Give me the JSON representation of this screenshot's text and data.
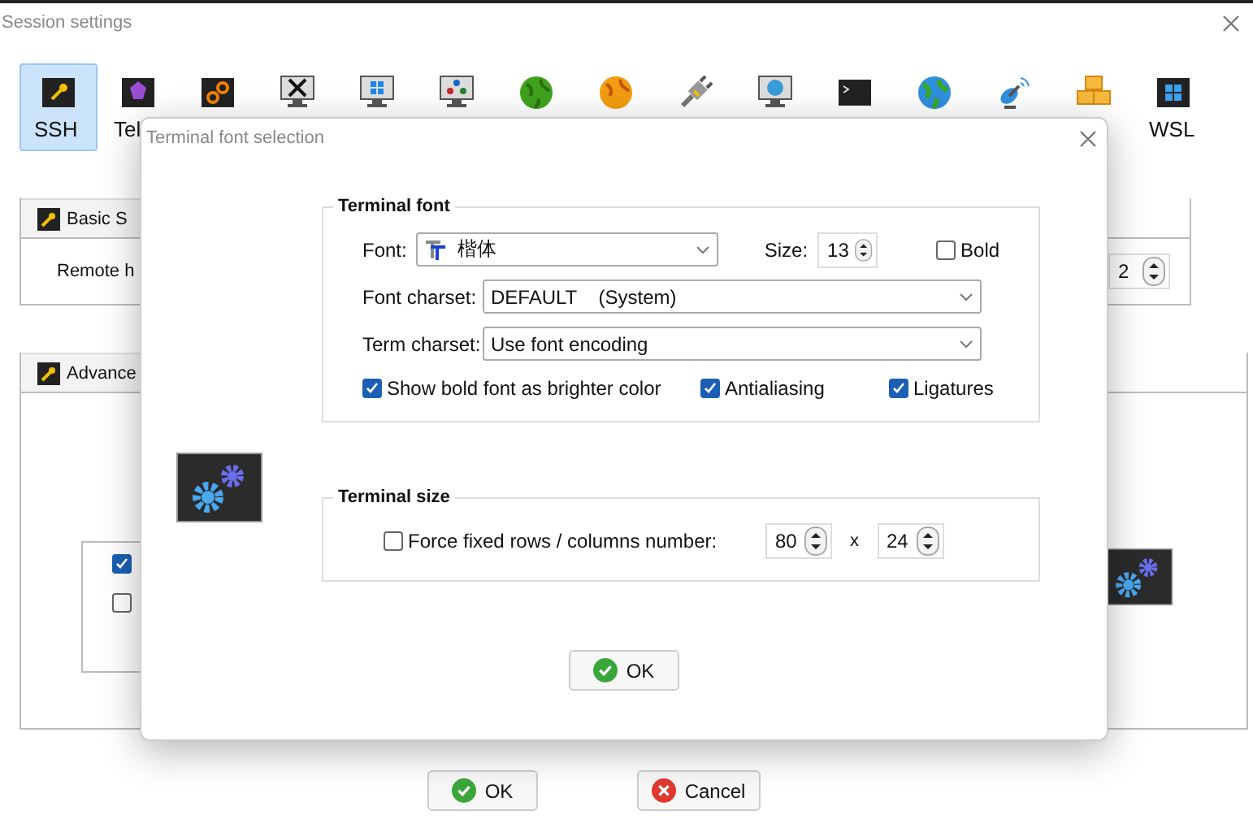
{
  "window": {
    "title": "Session settings"
  },
  "tools": [
    {
      "kind": "key",
      "label": "SSH",
      "selected": true
    },
    {
      "kind": "gem",
      "label": "Tel",
      "selected": false
    },
    {
      "kind": "gears",
      "selected": false
    },
    {
      "kind": "x-monitor",
      "selected": false
    },
    {
      "kind": "windows-monitor",
      "selected": false
    },
    {
      "kind": "vnc-monitor",
      "selected": false
    },
    {
      "kind": "green-globe",
      "selected": false
    },
    {
      "kind": "orange-globe",
      "selected": false
    },
    {
      "kind": "plug",
      "selected": false
    },
    {
      "kind": "globe-monitor",
      "selected": false
    },
    {
      "kind": "terminal",
      "selected": false
    },
    {
      "kind": "blue-globe",
      "selected": false
    },
    {
      "kind": "satellite",
      "selected": false
    },
    {
      "kind": "cubes",
      "selected": false
    },
    {
      "kind": "windows",
      "label": "WSL",
      "selected": false
    }
  ],
  "basic": {
    "tab": "Basic S",
    "field_label": "Remote h",
    "spin_value": "2"
  },
  "advanced": {
    "tab": "Advance",
    "options": [
      {
        "checked": true
      },
      {
        "checked": false
      }
    ]
  },
  "buttons": [
    {
      "kind": "ok",
      "label": "OK"
    },
    {
      "kind": "cancel",
      "label": "Cancel"
    }
  ],
  "dialog": {
    "title": "Terminal font selection",
    "font_group": {
      "title": "Terminal font",
      "font": {
        "label": "Font:",
        "value": "楷体"
      },
      "size": {
        "label": "Size:",
        "value": "13"
      },
      "bold": {
        "label": "Bold",
        "checked": false
      },
      "font_charset": {
        "label": "Font charset:",
        "value": "DEFAULT    (System)"
      },
      "term_charset": {
        "label": "Term charset:",
        "value": "Use font encoding"
      },
      "options": [
        {
          "label": "Show bold font as brighter color",
          "checked": true
        },
        {
          "label": "Antialiasing",
          "checked": true
        },
        {
          "label": "Ligatures",
          "checked": true
        }
      ]
    },
    "size_group": {
      "title": "Terminal size",
      "force": {
        "label": "Force fixed rows / columns number:",
        "checked": false
      },
      "columns": "80",
      "separator": "x",
      "rows": "24"
    },
    "ok": "OK"
  }
}
